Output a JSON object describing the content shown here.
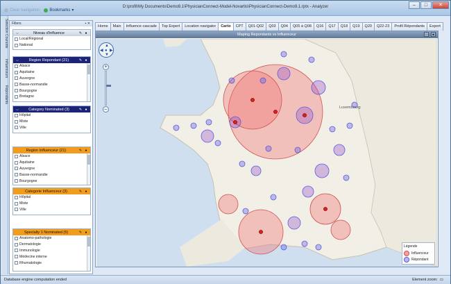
{
  "window": {
    "title": "D:\\profil\\My Documents\\Demo9.1\\PhysicianConnect-Model-Novartis\\PhysicianConnect-Demo9.1.rptx - Analyzer"
  },
  "toolbar": {
    "clear_nav": "Clear navigation",
    "bookmarks": "Bookmarks"
  },
  "side_tabs": [
    "Selection Courante",
    "Influenceurs",
    "Répondants"
  ],
  "filters": {
    "title": "Filters",
    "groups": [
      {
        "title": "Niveau d'influence",
        "items": [
          "Local/Régional",
          "National"
        ]
      },
      {
        "title": "Region Repondant (21)",
        "items": [
          "Alsace",
          "Aquitaine",
          "Auvergne",
          "Basse-normandie",
          "Bourgogne",
          "Bretagne"
        ]
      },
      {
        "title": "Category Nominated (3)",
        "items": [
          "Hôpital",
          "Mixte",
          "Ville"
        ]
      },
      {
        "title": "Region Influenceur (21)",
        "items": [
          "Alsace",
          "Aquitaine",
          "Auvergne",
          "Basse-normandie",
          "Bourgogne"
        ]
      },
      {
        "title": "Categorie Influenceur (3)",
        "items": [
          "Hôpital",
          "Mixte",
          "Ville"
        ]
      },
      {
        "title": "Specialty 1 Nominated (5)",
        "items": [
          "Anatomo-pathologie",
          "Dermatologie",
          "Immunologie",
          "Médecine interne",
          "Rhumatologie"
        ]
      }
    ]
  },
  "tabs": [
    "Home",
    "Main",
    "Influence cascade",
    "Top Expert",
    "Location navigator",
    "Carto",
    "CPT",
    "Q01-Q02",
    "Q03",
    "Q04",
    "Q05 à Q08",
    "Q16",
    "Q17",
    "Q18",
    "Q19",
    "Q20",
    "Q22-23",
    "Profil Répondants",
    "Export"
  ],
  "active_tab": "Carto",
  "map": {
    "title": "Maping Repondants vs Influenceur",
    "place_label": "Luxembourg",
    "legend": {
      "title": "Légende",
      "items": [
        {
          "label": "Influenceur",
          "color": "#f07070"
        },
        {
          "label": "Répondant",
          "color": "#6a6ae8"
        }
      ]
    }
  },
  "status": {
    "left": "Database engine computation ended",
    "zoom_label": "Element zoom:"
  },
  "colors": {
    "influencer": "#f06a6a",
    "respondent": "#5a5ae0",
    "header_navy": "#1c2477",
    "header_orange": "#f39b1d"
  }
}
